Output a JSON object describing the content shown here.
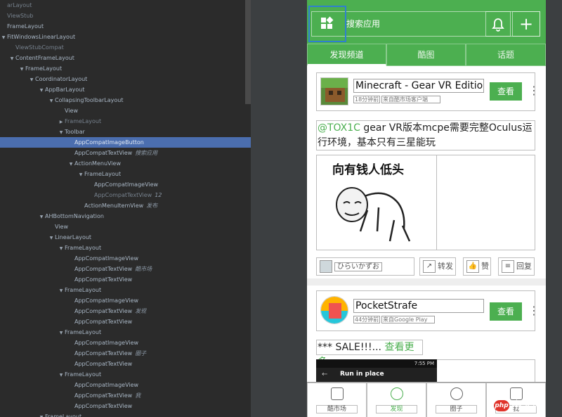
{
  "tree": {
    "nodes": [
      {
        "label": "arLayout",
        "depth": 0,
        "arrow": "",
        "dim": true
      },
      {
        "label": "ViewStub",
        "depth": 0,
        "arrow": "",
        "dim": true
      },
      {
        "label": "FrameLayout",
        "depth": 0,
        "arrow": ""
      },
      {
        "label": "FitWindowsLinearLayout",
        "depth": 0,
        "arrow": "▼"
      },
      {
        "label": "ViewStubCompat",
        "depth": 1,
        "arrow": "",
        "dim": true
      },
      {
        "label": "ContentFrameLayout",
        "depth": 1,
        "arrow": "▼"
      },
      {
        "label": "FrameLayout",
        "depth": 2,
        "arrow": "▼"
      },
      {
        "label": "CoordinatorLayout",
        "depth": 3,
        "arrow": "▼"
      },
      {
        "label": "AppBarLayout",
        "depth": 4,
        "arrow": "▼"
      },
      {
        "label": "CollapsingToolbarLayout",
        "depth": 5,
        "arrow": "▼"
      },
      {
        "label": "View",
        "depth": 6,
        "arrow": ""
      },
      {
        "label": "FrameLayout",
        "depth": 6,
        "arrow": "▶",
        "dim": true
      },
      {
        "label": "Toolbar",
        "depth": 6,
        "arrow": "▼"
      },
      {
        "label": "AppCompatImageButton",
        "depth": 7,
        "arrow": "",
        "selected": true
      },
      {
        "label": "AppCompatTextView",
        "depth": 7,
        "arrow": "",
        "hint": "搜索应用"
      },
      {
        "label": "ActionMenuView",
        "depth": 7,
        "arrow": "▼"
      },
      {
        "label": "FrameLayout",
        "depth": 8,
        "arrow": "▼"
      },
      {
        "label": "AppCompatImageView",
        "depth": 9,
        "arrow": ""
      },
      {
        "label": "AppCompatTextView",
        "depth": 9,
        "arrow": "",
        "hint": "12",
        "dim": true
      },
      {
        "label": "ActionMenuItemView",
        "depth": 8,
        "arrow": "",
        "hint": "发布"
      },
      {
        "label": "AHBottomNavigation",
        "depth": 4,
        "arrow": "▼"
      },
      {
        "label": "View",
        "depth": 5,
        "arrow": ""
      },
      {
        "label": "LinearLayout",
        "depth": 5,
        "arrow": "▼"
      },
      {
        "label": "FrameLayout",
        "depth": 6,
        "arrow": "▼"
      },
      {
        "label": "AppCompatImageView",
        "depth": 7,
        "arrow": ""
      },
      {
        "label": "AppCompatTextView",
        "depth": 7,
        "arrow": "",
        "hint": "酷市场"
      },
      {
        "label": "AppCompatTextView",
        "depth": 7,
        "arrow": ""
      },
      {
        "label": "FrameLayout",
        "depth": 6,
        "arrow": "▼"
      },
      {
        "label": "AppCompatImageView",
        "depth": 7,
        "arrow": ""
      },
      {
        "label": "AppCompatTextView",
        "depth": 7,
        "arrow": "",
        "hint": "发现"
      },
      {
        "label": "AppCompatTextView",
        "depth": 7,
        "arrow": ""
      },
      {
        "label": "FrameLayout",
        "depth": 6,
        "arrow": "▼"
      },
      {
        "label": "AppCompatImageView",
        "depth": 7,
        "arrow": ""
      },
      {
        "label": "AppCompatTextView",
        "depth": 7,
        "arrow": "",
        "hint": "圈子"
      },
      {
        "label": "AppCompatTextView",
        "depth": 7,
        "arrow": ""
      },
      {
        "label": "FrameLayout",
        "depth": 6,
        "arrow": "▼"
      },
      {
        "label": "AppCompatImageView",
        "depth": 7,
        "arrow": ""
      },
      {
        "label": "AppCompatTextView",
        "depth": 7,
        "arrow": "",
        "hint": "我"
      },
      {
        "label": "AppCompatTextView",
        "depth": 7,
        "arrow": ""
      },
      {
        "label": "FrameLayout",
        "depth": 4,
        "arrow": "▼"
      }
    ]
  },
  "phone": {
    "toolbar": {
      "search_label": "搜索应用",
      "bell_icon": "bell-icon",
      "plus_label": "+"
    },
    "tabs": [
      {
        "label": "发现频道",
        "active": true
      },
      {
        "label": "酷图",
        "active": false
      },
      {
        "label": "话题",
        "active": false
      }
    ],
    "card1": {
      "app_name": "Minecraft - Gear VR Edition",
      "time": "18分钟前",
      "source": "来自酷市场客户端",
      "get_label": "查看",
      "mention": "@TOX1C",
      "post_line1": " gear VR版本mcpe需要完整Oculus运",
      "post_line2": "行环境，基本只有三星能玩",
      "meme_text": "向有钱人低头",
      "user": "ひらいかずお",
      "repost": "转发",
      "like": "赞",
      "reply": "回复"
    },
    "card2": {
      "app_name": "PocketStrafe",
      "time": "44分钟前",
      "source": "来自Google Play",
      "get_label": "查看",
      "sale": "*** SALE!!!... ",
      "more": "查看更多",
      "shot_time": "7:55 PM",
      "shot_title": "Run in place"
    },
    "bottom_nav": [
      {
        "label": "酷市场",
        "icon": "cube-icon",
        "active": false
      },
      {
        "label": "发现",
        "icon": "bulb-icon",
        "active": true
      },
      {
        "label": "圈子",
        "icon": "circle-plus-icon",
        "active": false
      },
      {
        "label": "我",
        "icon": "person-icon",
        "active": false
      }
    ]
  },
  "watermark": {
    "badge": "php",
    "text": "中文网"
  },
  "colors": {
    "green": "#4caf50",
    "tree_bg": "#2b2b2b",
    "selection": "#4b6eaf"
  }
}
